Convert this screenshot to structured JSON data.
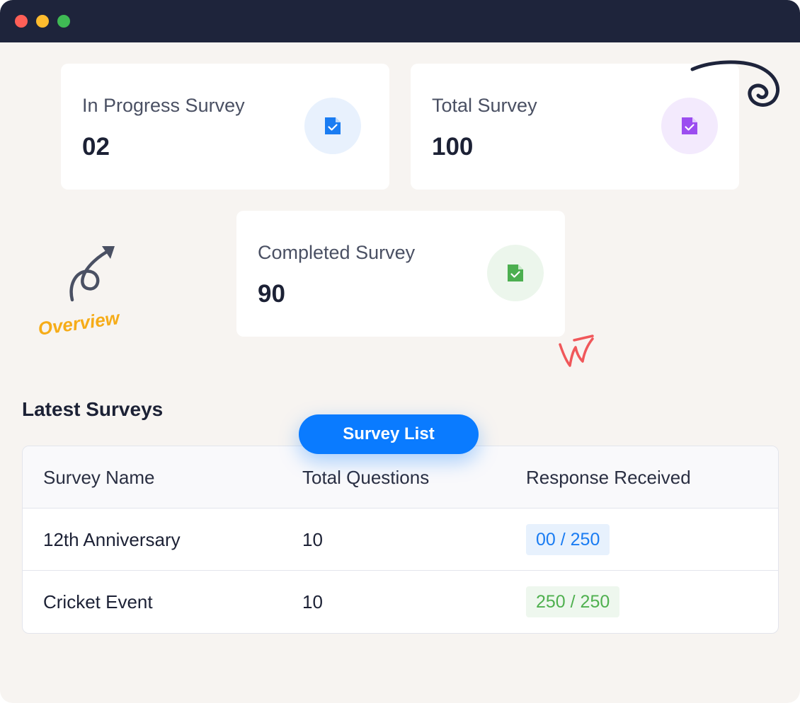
{
  "cards": {
    "in_progress": {
      "label": "In Progress Survey",
      "value": "02",
      "icon": "survey-check-icon",
      "accent": "#1a7cf2",
      "icon_bg": "#e8f1fd"
    },
    "total": {
      "label": "Total Survey",
      "value": "100",
      "icon": "survey-check-icon",
      "accent": "#9b4df0",
      "icon_bg": "#f3eafd"
    },
    "completed": {
      "label": "Completed Survey",
      "value": "90",
      "icon": "survey-check-icon",
      "accent": "#4caf50",
      "icon_bg": "#ecf6ec"
    }
  },
  "annotations": {
    "overview": "Overview"
  },
  "section": {
    "title": "Latest Surveys"
  },
  "survey_list_button": {
    "label": "Survey List"
  },
  "table": {
    "headers": [
      "Survey Name",
      "Total Questions",
      "Response Received"
    ],
    "rows": [
      {
        "name": "12th Anniversary",
        "questions": "10",
        "responses": "00 / 250",
        "status_color": "#1a7cf2"
      },
      {
        "name": "Cricket Event",
        "questions": "10",
        "responses": "250 / 250",
        "status_color": "#4fb04f"
      }
    ]
  }
}
